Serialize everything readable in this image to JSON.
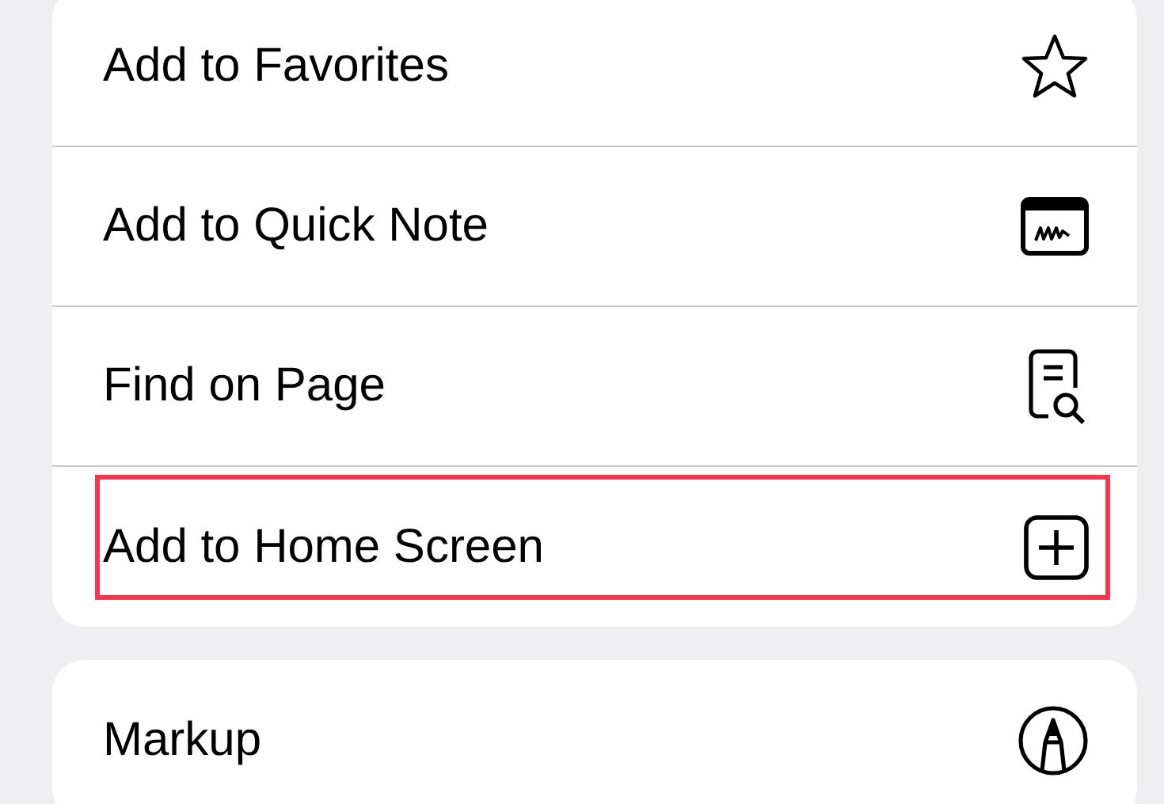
{
  "groups": [
    {
      "items": [
        {
          "label": "Add to Favorites",
          "highlighted": false
        },
        {
          "label": "Add to Quick Note",
          "highlighted": false
        },
        {
          "label": "Find on Page",
          "highlighted": false
        },
        {
          "label": "Add to Home Screen",
          "highlighted": true
        }
      ]
    },
    {
      "items": [
        {
          "label": "Markup",
          "highlighted": false
        }
      ]
    }
  ]
}
